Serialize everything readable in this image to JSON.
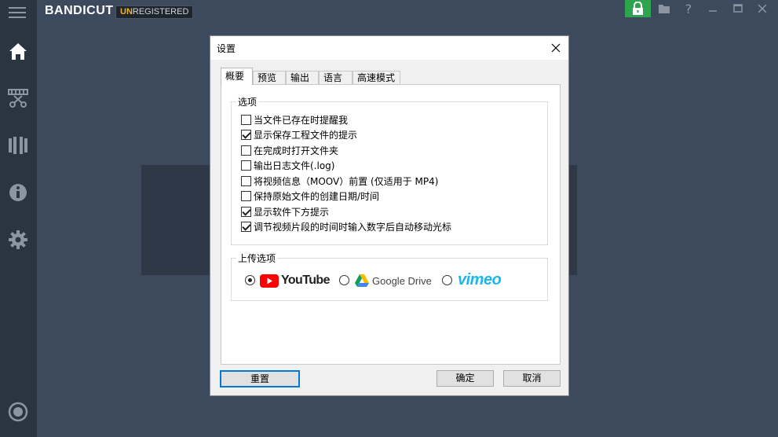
{
  "app": {
    "brand": "BANDICUT",
    "badge_prefix": "UN",
    "badge_rest": "REGISTERED"
  },
  "sidebar": {
    "items": [
      {
        "icon": "home-icon"
      },
      {
        "icon": "cut-icon"
      },
      {
        "icon": "join-icon"
      },
      {
        "icon": "info-icon"
      },
      {
        "icon": "gear-icon"
      },
      {
        "icon": "record-icon"
      }
    ]
  },
  "titlebar": {
    "icons": [
      "lock-icon",
      "folder-icon",
      "help-icon",
      "minimize-icon",
      "maximize-icon",
      "close-icon"
    ],
    "lock_color": "#2ea44f"
  },
  "dialog": {
    "title": "设置",
    "tabs": [
      {
        "label": "概要",
        "active": true
      },
      {
        "label": "预览"
      },
      {
        "label": "输出"
      },
      {
        "label": "语言"
      },
      {
        "label": "高速模式"
      }
    ],
    "options_group": {
      "label": "选项",
      "items": [
        {
          "label": "当文件已存在时提醒我",
          "checked": false
        },
        {
          "label": "显示保存工程文件的提示",
          "checked": true
        },
        {
          "label": "在完成时打开文件夹",
          "checked": false
        },
        {
          "label": "输出日志文件(.log)",
          "checked": false
        },
        {
          "label": "将视频信息（MOOV）前置 (仅适用于 MP4)",
          "checked": false
        },
        {
          "label": "保持原始文件的创建日期/时间",
          "checked": false
        },
        {
          "label": "显示软件下方提示",
          "checked": true
        },
        {
          "label": "调节视频片段的时间时输入数字后自动移动光标",
          "checked": true
        }
      ]
    },
    "upload_group": {
      "label": "上传选项",
      "services": [
        {
          "name": "YouTube",
          "selected": true
        },
        {
          "name": "Google Drive",
          "selected": false
        },
        {
          "name": "vimeo",
          "selected": false
        }
      ]
    },
    "buttons": {
      "reset": "重置",
      "ok": "确定",
      "cancel": "取消"
    }
  }
}
